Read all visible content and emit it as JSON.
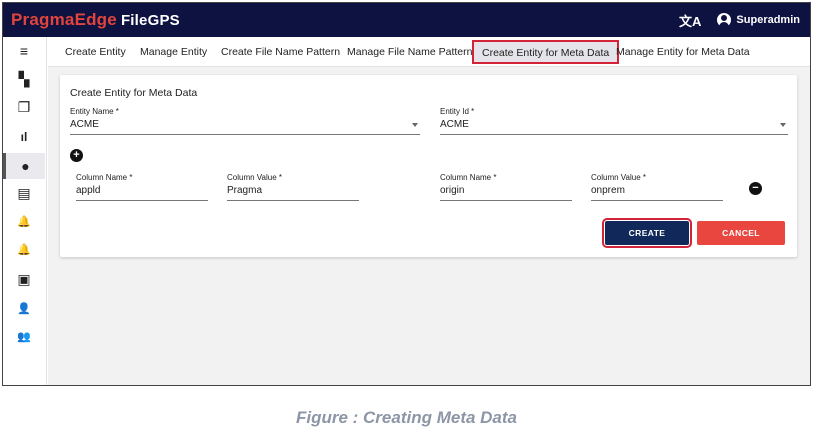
{
  "app": {
    "brand_part1": "PragmaEdge",
    "brand_part2": "FileGPS",
    "translate_icon": "文A",
    "user_name": "Superadmin"
  },
  "sidebar": {
    "items": [
      {
        "icon": "menu-icon",
        "glyph": "≡",
        "active": false
      },
      {
        "icon": "dashboard-icon",
        "glyph": "▚",
        "active": false
      },
      {
        "icon": "copy-icon",
        "glyph": "❐",
        "active": false
      },
      {
        "icon": "bar-chart-icon",
        "glyph": "ıl",
        "active": false
      },
      {
        "icon": "account-circle-icon",
        "glyph": "●",
        "active": true
      },
      {
        "icon": "document-icon",
        "glyph": "▤",
        "active": false
      },
      {
        "icon": "bell-alert-icon",
        "glyph": "🔔",
        "active": false
      },
      {
        "icon": "bell-settings-icon",
        "glyph": "🔔",
        "active": false
      },
      {
        "icon": "box-settings-icon",
        "glyph": "▣",
        "active": false
      },
      {
        "icon": "user-settings-icon",
        "glyph": "👤",
        "active": false
      },
      {
        "icon": "group-icon",
        "glyph": "👥",
        "active": false
      }
    ]
  },
  "tabs": [
    {
      "label": "Create Entity",
      "active": false
    },
    {
      "label": "Manage Entity",
      "active": false
    },
    {
      "label": "Create File Name Pattern",
      "active": false
    },
    {
      "label": "Manage File Name Pattern",
      "active": false
    },
    {
      "label": "Create Entity for Meta Data",
      "active": true
    },
    {
      "label": "Manage Entity for Meta Data",
      "active": false
    }
  ],
  "form": {
    "title": "Create Entity for Meta Data",
    "entity_name": {
      "label": "Entity Name *",
      "value": "ACME"
    },
    "entity_id": {
      "label": "Entity Id *",
      "value": "ACME"
    },
    "add_icon": "+",
    "remove_icon": "−",
    "columns": [
      {
        "name_label": "Column Name *",
        "name_value": "appld",
        "value_label": "Column Value *",
        "value_value": "Pragma"
      },
      {
        "name_label": "Column Name *",
        "name_value": "origin",
        "value_label": "Column Value *",
        "value_value": "onprem"
      }
    ],
    "create_label": "CREATE",
    "cancel_label": "CANCEL"
  },
  "colors": {
    "topbar": "#0d1240",
    "brand_accent": "#e0443c",
    "create_button": "#10285a",
    "cancel_button": "#e9463f",
    "highlight": "#d3233a"
  },
  "caption": "Figure : Creating Meta Data"
}
